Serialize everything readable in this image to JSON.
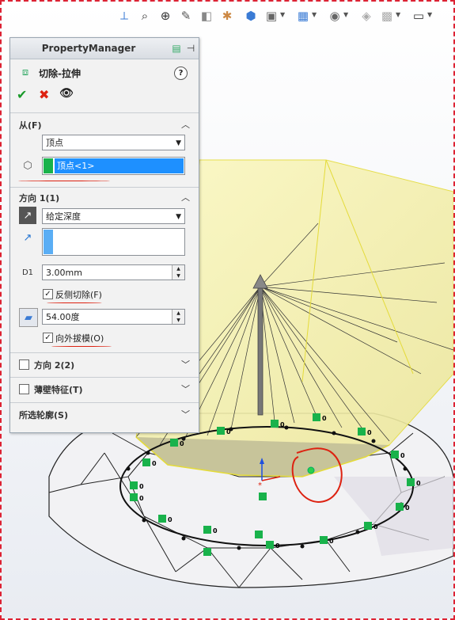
{
  "toolbar": {
    "icons": [
      "view-orientation-icon",
      "zoom-to-fit-icon",
      "zoom-area-icon",
      "previous-view-icon",
      "section-view-icon",
      "dynamic-annotation-icon",
      "view-orientation-cube-icon",
      "display-style-icon",
      "hide-show-icon",
      "edit-appearance-icon",
      "apply-scene-icon",
      "view-settings-icon",
      "monitor-icon"
    ]
  },
  "property_manager": {
    "title": "PropertyManager",
    "feature_name": "切除-拉伸",
    "help": "?",
    "actions": {
      "ok": "✔",
      "cancel": "✖",
      "preview": "👁"
    },
    "from": {
      "title": "从(F)",
      "option": "顶点",
      "selection": "顶点<1>"
    },
    "direction1": {
      "title": "方向 1(1)",
      "end_condition": "给定深度",
      "depth": "3.00mm",
      "flip_side_label": "反侧切除(F)",
      "flip_side_checked": true,
      "draft_angle": "54.00度",
      "draft_outward_label": "向外拔模(O)",
      "draft_outward_checked": true
    },
    "direction2": {
      "title": "方向 2(2)",
      "checked": false
    },
    "thin_feature": {
      "title": "薄壁特征(T)",
      "checked": false
    },
    "selected_contours": {
      "title": "所选轮廓(S)"
    }
  },
  "dimension_labels": [
    "D1"
  ],
  "colors": {
    "accent_green": "#19b24b",
    "selection_blue": "#1e90ff",
    "preview_yellow": "#f7f3a6",
    "annotation_red": "#d21"
  }
}
